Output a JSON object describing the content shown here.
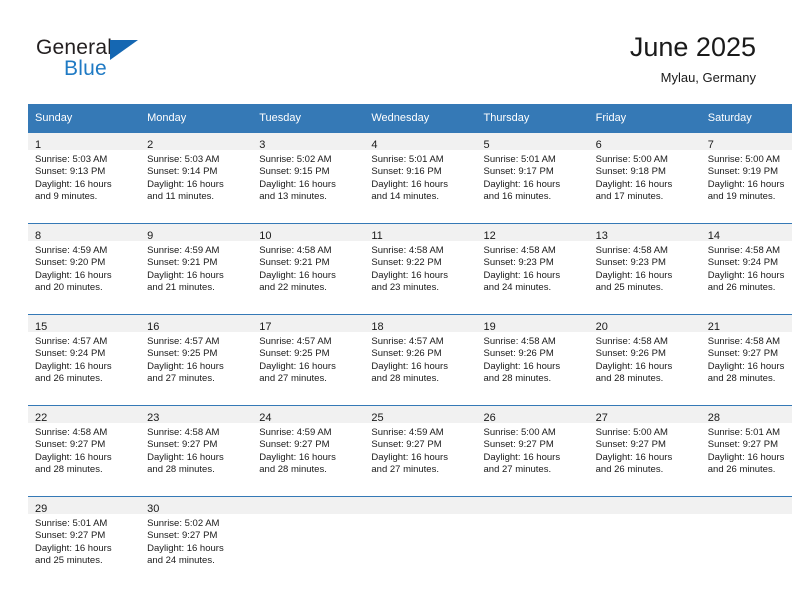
{
  "brand": {
    "name_line1": "General",
    "name_line2": "Blue",
    "flag_icon": "blue-triangle-flag-icon",
    "color_primary": "#1567b2",
    "color_text": "#231f20"
  },
  "header": {
    "month_title": "June 2025",
    "location": "Mylau, Germany"
  },
  "theme": {
    "header_blue": "#3579b6",
    "daynum_band_gray": "#f1f1f1",
    "text": "#1a1a1a"
  },
  "calendar": {
    "weekday_headers": [
      "Sunday",
      "Monday",
      "Tuesday",
      "Wednesday",
      "Thursday",
      "Friday",
      "Saturday"
    ],
    "labels": {
      "sunrise_prefix": "Sunrise:",
      "sunset_prefix": "Sunset:",
      "daylight_prefix": "Daylight:"
    },
    "weeks": [
      [
        {
          "day": "1",
          "sunrise": "Sunrise: 5:03 AM",
          "sunset": "Sunset: 9:13 PM",
          "daylight_line1": "Daylight: 16 hours",
          "daylight_line2": "and 9 minutes."
        },
        {
          "day": "2",
          "sunrise": "Sunrise: 5:03 AM",
          "sunset": "Sunset: 9:14 PM",
          "daylight_line1": "Daylight: 16 hours",
          "daylight_line2": "and 11 minutes."
        },
        {
          "day": "3",
          "sunrise": "Sunrise: 5:02 AM",
          "sunset": "Sunset: 9:15 PM",
          "daylight_line1": "Daylight: 16 hours",
          "daylight_line2": "and 13 minutes."
        },
        {
          "day": "4",
          "sunrise": "Sunrise: 5:01 AM",
          "sunset": "Sunset: 9:16 PM",
          "daylight_line1": "Daylight: 16 hours",
          "daylight_line2": "and 14 minutes."
        },
        {
          "day": "5",
          "sunrise": "Sunrise: 5:01 AM",
          "sunset": "Sunset: 9:17 PM",
          "daylight_line1": "Daylight: 16 hours",
          "daylight_line2": "and 16 minutes."
        },
        {
          "day": "6",
          "sunrise": "Sunrise: 5:00 AM",
          "sunset": "Sunset: 9:18 PM",
          "daylight_line1": "Daylight: 16 hours",
          "daylight_line2": "and 17 minutes."
        },
        {
          "day": "7",
          "sunrise": "Sunrise: 5:00 AM",
          "sunset": "Sunset: 9:19 PM",
          "daylight_line1": "Daylight: 16 hours",
          "daylight_line2": "and 19 minutes."
        }
      ],
      [
        {
          "day": "8",
          "sunrise": "Sunrise: 4:59 AM",
          "sunset": "Sunset: 9:20 PM",
          "daylight_line1": "Daylight: 16 hours",
          "daylight_line2": "and 20 minutes."
        },
        {
          "day": "9",
          "sunrise": "Sunrise: 4:59 AM",
          "sunset": "Sunset: 9:21 PM",
          "daylight_line1": "Daylight: 16 hours",
          "daylight_line2": "and 21 minutes."
        },
        {
          "day": "10",
          "sunrise": "Sunrise: 4:58 AM",
          "sunset": "Sunset: 9:21 PM",
          "daylight_line1": "Daylight: 16 hours",
          "daylight_line2": "and 22 minutes."
        },
        {
          "day": "11",
          "sunrise": "Sunrise: 4:58 AM",
          "sunset": "Sunset: 9:22 PM",
          "daylight_line1": "Daylight: 16 hours",
          "daylight_line2": "and 23 minutes."
        },
        {
          "day": "12",
          "sunrise": "Sunrise: 4:58 AM",
          "sunset": "Sunset: 9:23 PM",
          "daylight_line1": "Daylight: 16 hours",
          "daylight_line2": "and 24 minutes."
        },
        {
          "day": "13",
          "sunrise": "Sunrise: 4:58 AM",
          "sunset": "Sunset: 9:23 PM",
          "daylight_line1": "Daylight: 16 hours",
          "daylight_line2": "and 25 minutes."
        },
        {
          "day": "14",
          "sunrise": "Sunrise: 4:58 AM",
          "sunset": "Sunset: 9:24 PM",
          "daylight_line1": "Daylight: 16 hours",
          "daylight_line2": "and 26 minutes."
        }
      ],
      [
        {
          "day": "15",
          "sunrise": "Sunrise: 4:57 AM",
          "sunset": "Sunset: 9:24 PM",
          "daylight_line1": "Daylight: 16 hours",
          "daylight_line2": "and 26 minutes."
        },
        {
          "day": "16",
          "sunrise": "Sunrise: 4:57 AM",
          "sunset": "Sunset: 9:25 PM",
          "daylight_line1": "Daylight: 16 hours",
          "daylight_line2": "and 27 minutes."
        },
        {
          "day": "17",
          "sunrise": "Sunrise: 4:57 AM",
          "sunset": "Sunset: 9:25 PM",
          "daylight_line1": "Daylight: 16 hours",
          "daylight_line2": "and 27 minutes."
        },
        {
          "day": "18",
          "sunrise": "Sunrise: 4:57 AM",
          "sunset": "Sunset: 9:26 PM",
          "daylight_line1": "Daylight: 16 hours",
          "daylight_line2": "and 28 minutes."
        },
        {
          "day": "19",
          "sunrise": "Sunrise: 4:58 AM",
          "sunset": "Sunset: 9:26 PM",
          "daylight_line1": "Daylight: 16 hours",
          "daylight_line2": "and 28 minutes."
        },
        {
          "day": "20",
          "sunrise": "Sunrise: 4:58 AM",
          "sunset": "Sunset: 9:26 PM",
          "daylight_line1": "Daylight: 16 hours",
          "daylight_line2": "and 28 minutes."
        },
        {
          "day": "21",
          "sunrise": "Sunrise: 4:58 AM",
          "sunset": "Sunset: 9:27 PM",
          "daylight_line1": "Daylight: 16 hours",
          "daylight_line2": "and 28 minutes."
        }
      ],
      [
        {
          "day": "22",
          "sunrise": "Sunrise: 4:58 AM",
          "sunset": "Sunset: 9:27 PM",
          "daylight_line1": "Daylight: 16 hours",
          "daylight_line2": "and 28 minutes."
        },
        {
          "day": "23",
          "sunrise": "Sunrise: 4:58 AM",
          "sunset": "Sunset: 9:27 PM",
          "daylight_line1": "Daylight: 16 hours",
          "daylight_line2": "and 28 minutes."
        },
        {
          "day": "24",
          "sunrise": "Sunrise: 4:59 AM",
          "sunset": "Sunset: 9:27 PM",
          "daylight_line1": "Daylight: 16 hours",
          "daylight_line2": "and 28 minutes."
        },
        {
          "day": "25",
          "sunrise": "Sunrise: 4:59 AM",
          "sunset": "Sunset: 9:27 PM",
          "daylight_line1": "Daylight: 16 hours",
          "daylight_line2": "and 27 minutes."
        },
        {
          "day": "26",
          "sunrise": "Sunrise: 5:00 AM",
          "sunset": "Sunset: 9:27 PM",
          "daylight_line1": "Daylight: 16 hours",
          "daylight_line2": "and 27 minutes."
        },
        {
          "day": "27",
          "sunrise": "Sunrise: 5:00 AM",
          "sunset": "Sunset: 9:27 PM",
          "daylight_line1": "Daylight: 16 hours",
          "daylight_line2": "and 26 minutes."
        },
        {
          "day": "28",
          "sunrise": "Sunrise: 5:01 AM",
          "sunset": "Sunset: 9:27 PM",
          "daylight_line1": "Daylight: 16 hours",
          "daylight_line2": "and 26 minutes."
        }
      ],
      [
        {
          "day": "29",
          "sunrise": "Sunrise: 5:01 AM",
          "sunset": "Sunset: 9:27 PM",
          "daylight_line1": "Daylight: 16 hours",
          "daylight_line2": "and 25 minutes."
        },
        {
          "day": "30",
          "sunrise": "Sunrise: 5:02 AM",
          "sunset": "Sunset: 9:27 PM",
          "daylight_line1": "Daylight: 16 hours",
          "daylight_line2": "and 24 minutes."
        },
        {
          "day": "",
          "sunrise": "",
          "sunset": "",
          "daylight_line1": "",
          "daylight_line2": ""
        },
        {
          "day": "",
          "sunrise": "",
          "sunset": "",
          "daylight_line1": "",
          "daylight_line2": ""
        },
        {
          "day": "",
          "sunrise": "",
          "sunset": "",
          "daylight_line1": "",
          "daylight_line2": ""
        },
        {
          "day": "",
          "sunrise": "",
          "sunset": "",
          "daylight_line1": "",
          "daylight_line2": ""
        },
        {
          "day": "",
          "sunrise": "",
          "sunset": "",
          "daylight_line1": "",
          "daylight_line2": ""
        }
      ]
    ]
  }
}
